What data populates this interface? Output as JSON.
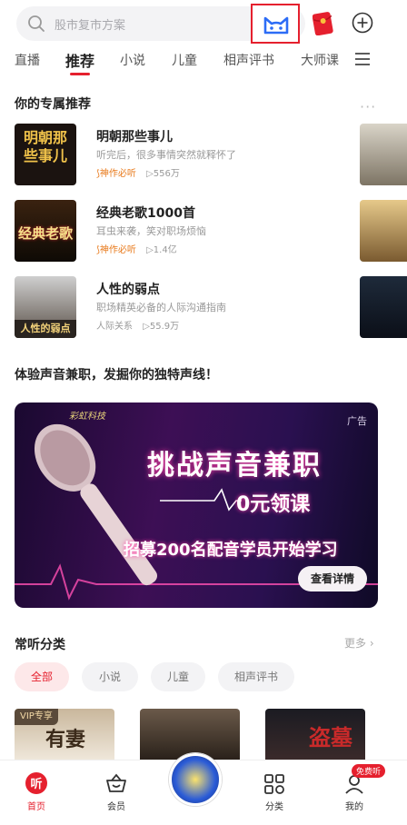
{
  "search": {
    "placeholder": "股市复市方案"
  },
  "tabs": [
    {
      "label": "直播"
    },
    {
      "label": "推荐"
    },
    {
      "label": "小说"
    },
    {
      "label": "儿童"
    },
    {
      "label": "相声评书"
    },
    {
      "label": "大师课"
    }
  ],
  "recommend": {
    "title": "你的专属推荐",
    "more": "···",
    "items": [
      {
        "title": "明朝那些事儿",
        "desc": "听完后，很多事情突然就释怀了",
        "badge": "神作必听",
        "plays": "▷556万",
        "cover_text": "明朝那些事儿"
      },
      {
        "title": "经典老歌1000首",
        "desc": "耳虫来袭，笑对职场烦恼",
        "badge": "神作必听",
        "plays": "▷1.4亿",
        "cover_text": "经典老歌"
      },
      {
        "title": "人性的弱点",
        "desc": "职场精英必备的人际沟通指南",
        "tag": "人际关系",
        "plays": "▷55.9万",
        "cover_text": "人性的弱点"
      }
    ]
  },
  "ad_section": {
    "title": "体验声音兼职，发掘你的独特声线！",
    "ad_label": "广告",
    "brand": "彩虹科技",
    "headline": "挑战声音兼职",
    "subline": "0元领课",
    "tagline": "招募200名配音学员开始学习",
    "cta": "查看详情"
  },
  "categories": {
    "title": "常听分类",
    "more": "更多 ›",
    "chips": [
      {
        "label": "全部"
      },
      {
        "label": "小说"
      },
      {
        "label": "儿童"
      },
      {
        "label": "相声评书"
      }
    ],
    "vip_badge": "VIP专享",
    "card_texts": [
      "有妻",
      "盗墓"
    ]
  },
  "bottom_nav": {
    "items": [
      {
        "label": "首页",
        "icon": "home-listen-icon"
      },
      {
        "label": "会员",
        "icon": "vip-basket-icon"
      },
      {
        "label": "",
        "icon": "center-play-disc"
      },
      {
        "label": "分类",
        "icon": "category-grid-icon"
      },
      {
        "label": "我的",
        "icon": "profile-icon"
      }
    ],
    "free_badge": "免费听"
  },
  "colors": {
    "accent": "#e5202e",
    "badge_orange": "#e8791a"
  }
}
